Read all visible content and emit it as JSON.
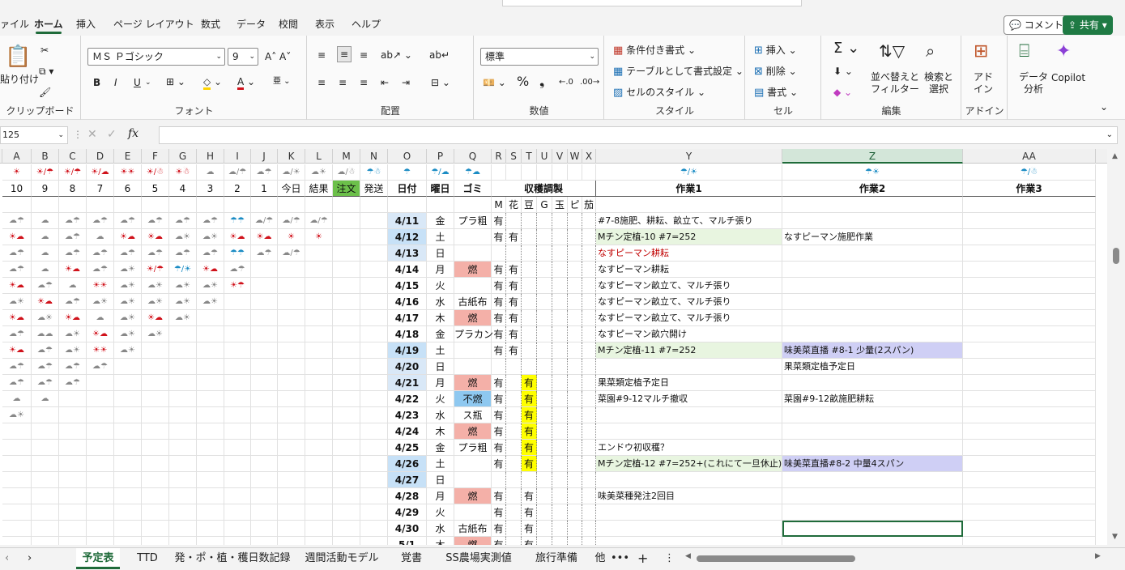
{
  "menu": {
    "tabs": [
      "ァイル",
      "ホーム",
      "挿入",
      "ページ レイアウト",
      "数式",
      "データ",
      "校閲",
      "表示",
      "ヘルプ"
    ],
    "comment_label": "コメント",
    "share_label": "共有"
  },
  "ribbon": {
    "clipboard": {
      "paste": "貼り付け",
      "label": "クリップボード"
    },
    "font": {
      "name": "ＭＳ Ｐゴシック",
      "size": "9",
      "label": "フォント",
      "bold": "B",
      "italic": "I",
      "underline": "U"
    },
    "alignment": {
      "label": "配置"
    },
    "number": {
      "format": "標準",
      "label": "数値"
    },
    "styles": {
      "cond": "条件付き書式",
      "table": "テーブルとして書式設定",
      "cell": "セルのスタイル",
      "label": "スタイル"
    },
    "cells": {
      "insert": "挿入",
      "delete": "削除",
      "format": "書式",
      "label": "セル"
    },
    "editing": {
      "sort": "並べ替えと\nフィルター",
      "find": "検索と\n選択",
      "label": "編集"
    },
    "addins": {
      "addin": "アド\nイン",
      "analyze": "データ\n分析",
      "copilot": "Copilot",
      "label": "アドイン"
    }
  },
  "formula_bar": {
    "name_box": "125",
    "fx": "fx",
    "value": ""
  },
  "columns": [
    {
      "h": "A",
      "w": 36
    },
    {
      "h": "B",
      "w": 34
    },
    {
      "h": "C",
      "w": 34
    },
    {
      "h": "D",
      "w": 34
    },
    {
      "h": "E",
      "w": 34
    },
    {
      "h": "F",
      "w": 34
    },
    {
      "h": "G",
      "w": 34
    },
    {
      "h": "H",
      "w": 34
    },
    {
      "h": "I",
      "w": 33
    },
    {
      "h": "J",
      "w": 33
    },
    {
      "h": "K",
      "w": 34
    },
    {
      "h": "L",
      "w": 34
    },
    {
      "h": "M",
      "w": 34
    },
    {
      "h": "N",
      "w": 34
    },
    {
      "h": "O",
      "w": 48
    },
    {
      "h": "P",
      "w": 34
    },
    {
      "h": "Q",
      "w": 46
    },
    {
      "h": "R",
      "w": 18
    },
    {
      "h": "S",
      "w": 19
    },
    {
      "h": "T",
      "w": 19
    },
    {
      "h": "U",
      "w": 19
    },
    {
      "h": "V",
      "w": 19
    },
    {
      "h": "W",
      "w": 18
    },
    {
      "h": "X",
      "w": 17
    },
    {
      "h": "Y",
      "w": 230
    },
    {
      "h": "Z",
      "w": 223
    },
    {
      "h": "AA",
      "w": 164
    }
  ],
  "weather_header": [
    "☀",
    "☀/☂",
    "☀/☂",
    "☀/☁",
    "☀☀",
    "☀/☃",
    "☀☃",
    "☁",
    "☁/☂",
    "☁☂",
    "☁/☀",
    "☁☀",
    "☁/☃",
    "☂☃",
    "☂",
    "☂/☁",
    "☂☁",
    "",
    "",
    "",
    "",
    "",
    "",
    "",
    "☂/☀",
    "☂☀",
    "☂/☃"
  ],
  "header_row": [
    "10",
    "9",
    "8",
    "7",
    "6",
    "5",
    "4",
    "3",
    "2",
    "1",
    "今日",
    "結果",
    "注文",
    "発送",
    "日付",
    "曜日",
    "ゴミ",
    "収穫調製",
    "",
    "",
    "",
    "",
    "",
    "",
    "作業1",
    "作業2",
    "作業3"
  ],
  "crop_header": [
    "M",
    "花",
    "豆",
    "G",
    "玉",
    "ピ",
    "茄"
  ],
  "rows": [
    {
      "w": [
        "☁☂",
        "☁",
        "☁☂",
        "☁☂",
        "☁☂",
        "☁☂",
        "☁☂",
        "☁☂",
        "☂☂",
        "☁/☂",
        "☁/☂",
        "☁/☂"
      ],
      "date": "4/11",
      "dow": "金",
      "gomi": "プラ粗",
      "crops": [
        "有",
        "",
        "",
        "",
        "",
        "",
        ""
      ],
      "t1": "#7-8施肥、耕耘、畝立て、マルチ張り",
      "t2": ""
    },
    {
      "w": [
        "☀☁",
        "☁",
        "☁☂",
        "☁",
        "☀☁",
        "☀☁",
        "☁☀",
        "☁☀",
        "☀☁",
        "☀☁",
        "☀",
        "☀"
      ],
      "date": "4/12",
      "dow": "土",
      "gomi": "",
      "crops": [
        "有",
        "有",
        "",
        "",
        "",
        "",
        ""
      ],
      "t1": "Mチン定植-10 #7=252",
      "t2": "なすピーマン施肥作業"
    },
    {
      "w": [
        "☁☂",
        "☁",
        "☁☂",
        "☁☂",
        "☁☂",
        "☁☂",
        "☁☂",
        "☁☂",
        "☂☂",
        "☁☂",
        "☁/☂",
        ""
      ],
      "date": "4/13",
      "dow": "日",
      "gomi": "",
      "crops": [
        "",
        "",
        "",
        "",
        "",
        "",
        ""
      ],
      "t1": "なすピーマン耕耘",
      "t2": ""
    },
    {
      "w": [
        "☁☂",
        "☁",
        "☀☁",
        "☁☂",
        "☁☀",
        "☀/☂",
        "☂/☀",
        "☀☁",
        "☁☂",
        "",
        "",
        ""
      ],
      "date": "4/14",
      "dow": "月",
      "gomi": "燃",
      "crops": [
        "有",
        "有",
        "",
        "",
        "",
        "",
        ""
      ],
      "t1": "なすピーマン耕耘",
      "t2": ""
    },
    {
      "w": [
        "☀☁",
        "☁☂",
        "☁",
        "☀☀",
        "☁☀",
        "☁☀",
        "☁☀",
        "☁☀",
        "☀☂",
        "",
        "",
        ""
      ],
      "date": "4/15",
      "dow": "火",
      "gomi": "",
      "crops": [
        "有",
        "有",
        "",
        "",
        "",
        "",
        ""
      ],
      "t1": "なすピーマン畝立て、マルチ張り",
      "t2": ""
    },
    {
      "w": [
        "☁☀",
        "☀☁",
        "☁☂",
        "☁☀",
        "☁☀",
        "☁☀",
        "☁☀",
        "☁☀",
        "",
        "",
        "",
        ""
      ],
      "date": "4/16",
      "dow": "水",
      "gomi": "古紙布",
      "crops": [
        "有",
        "有",
        "",
        "",
        "",
        "",
        ""
      ],
      "t1": "なすピーマン畝立て、マルチ張り",
      "t2": ""
    },
    {
      "w": [
        "☀☁",
        "☁☀",
        "☀☁",
        "☁",
        "☁☀",
        "☀☁",
        "☁☀",
        "",
        "",
        "",
        "",
        ""
      ],
      "date": "4/17",
      "dow": "木",
      "gomi": "燃",
      "crops": [
        "有",
        "有",
        "",
        "",
        "",
        "",
        ""
      ],
      "t1": "なすピーマン畝立て、マルチ張り",
      "t2": ""
    },
    {
      "w": [
        "☁☂",
        "☁☁",
        "☁☀",
        "☀☁",
        "☁☀",
        "☁☀",
        "",
        "",
        "",
        "",
        "",
        ""
      ],
      "date": "4/18",
      "dow": "金",
      "gomi": "プラカン",
      "crops": [
        "有",
        "有",
        "",
        "",
        "",
        "",
        ""
      ],
      "t1": "なすピーマン畝穴開け",
      "t2": ""
    },
    {
      "w": [
        "☀☁",
        "☁☂",
        "☁☀",
        "☀☀",
        "☁☀",
        "",
        "",
        "",
        "",
        "",
        "",
        ""
      ],
      "date": "4/19",
      "dow": "土",
      "gomi": "",
      "crops": [
        "有",
        "有",
        "",
        "",
        "",
        "",
        ""
      ],
      "t1": "Mチン定植-11 #7=252",
      "t2": "味美菜直播 #8-1  少量(2スパン)"
    },
    {
      "w": [
        "☁☂",
        "☁☂",
        "☁☂",
        "☁☂",
        "",
        "",
        "",
        "",
        "",
        "",
        "",
        ""
      ],
      "date": "4/20",
      "dow": "日",
      "gomi": "",
      "crops": [
        "",
        "",
        "",
        "",
        "",
        "",
        ""
      ],
      "t1": "",
      "t2": "果菜類定植予定日"
    },
    {
      "w": [
        "☁☂",
        "☁☂",
        "☁☂",
        "",
        "",
        "",
        "",
        "",
        "",
        "",
        "",
        ""
      ],
      "date": "4/21",
      "dow": "月",
      "gomi": "燃",
      "crops": [
        "有",
        "",
        "有",
        "",
        "",
        "",
        ""
      ],
      "t1": "果菜類定植予定日",
      "t2": ""
    },
    {
      "w": [
        "☁",
        "☁",
        "",
        "",
        "",
        "",
        "",
        "",
        "",
        "",
        "",
        ""
      ],
      "date": "4/22",
      "dow": "火",
      "gomi": "不燃",
      "crops": [
        "有",
        "",
        "有",
        "",
        "",
        "",
        ""
      ],
      "t1": "菜園#9-12マルチ撤収",
      "t2": "菜園#9-12畝施肥耕耘"
    },
    {
      "w": [
        "☁☀",
        "",
        "",
        "",
        "",
        "",
        "",
        "",
        "",
        "",
        "",
        ""
      ],
      "date": "4/23",
      "dow": "水",
      "gomi": "ス瓶",
      "crops": [
        "有",
        "",
        "有",
        "",
        "",
        "",
        ""
      ],
      "t1": "",
      "t2": ""
    },
    {
      "w": [
        "",
        "",
        "",
        "",
        "",
        "",
        "",
        "",
        "",
        "",
        "",
        ""
      ],
      "date": "4/24",
      "dow": "木",
      "gomi": "燃",
      "crops": [
        "有",
        "",
        "有",
        "",
        "",
        "",
        ""
      ],
      "t1": "",
      "t2": ""
    },
    {
      "w": [
        "",
        "",
        "",
        "",
        "",
        "",
        "",
        "",
        "",
        "",
        "",
        ""
      ],
      "date": "4/25",
      "dow": "金",
      "gomi": "プラ粗",
      "crops": [
        "有",
        "",
        "有",
        "",
        "",
        "",
        ""
      ],
      "t1": "エンドウ初収穫？",
      "t2": ""
    },
    {
      "w": [
        "",
        "",
        "",
        "",
        "",
        "",
        "",
        "",
        "",
        "",
        "",
        ""
      ],
      "date": "4/26",
      "dow": "土",
      "gomi": "",
      "crops": [
        "有",
        "",
        "有",
        "",
        "",
        "",
        ""
      ],
      "t1": "Mチン定植-12 #7=252+(これにて一旦休止)",
      "t2": "味美菜直播#8-2  中量4スパン"
    },
    {
      "w": [
        "",
        "",
        "",
        "",
        "",
        "",
        "",
        "",
        "",
        "",
        "",
        ""
      ],
      "date": "4/27",
      "dow": "日",
      "gomi": "",
      "crops": [
        "",
        "",
        "",
        "",
        "",
        "",
        ""
      ],
      "t1": "",
      "t2": ""
    },
    {
      "w": [
        "",
        "",
        "",
        "",
        "",
        "",
        "",
        "",
        "",
        "",
        "",
        ""
      ],
      "date": "4/28",
      "dow": "月",
      "gomi": "燃",
      "crops": [
        "有",
        "",
        "有",
        "",
        "",
        "",
        ""
      ],
      "t1": "味美菜種発注2回目",
      "t2": ""
    },
    {
      "w": [
        "",
        "",
        "",
        "",
        "",
        "",
        "",
        "",
        "",
        "",
        "",
        ""
      ],
      "date": "4/29",
      "dow": "火",
      "gomi": "",
      "crops": [
        "有",
        "",
        "有",
        "",
        "",
        "",
        ""
      ],
      "t1": "",
      "t2": ""
    },
    {
      "w": [
        "",
        "",
        "",
        "",
        "",
        "",
        "",
        "",
        "",
        "",
        "",
        ""
      ],
      "date": "4/30",
      "dow": "水",
      "gomi": "古紙布",
      "crops": [
        "有",
        "",
        "有",
        "",
        "",
        "",
        ""
      ],
      "t1": "",
      "t2": ""
    },
    {
      "w": [
        "",
        "",
        "",
        "",
        "",
        "",
        "",
        "",
        "",
        "",
        "",
        ""
      ],
      "date": "5/1",
      "dow": "木",
      "gomi": "燃",
      "crops": [
        "有",
        "",
        "有",
        "",
        "",
        "",
        ""
      ],
      "t1": "",
      "t2": ""
    }
  ],
  "sheet_tabs": [
    "予定表",
    "TTD",
    "発・ポ・植・穫日数記録",
    "週間活動モデル",
    "覚書",
    "SS農場実測値",
    "旅行準備",
    "他"
  ],
  "colors": {
    "accent": "#1f6b3a",
    "date_bg": "#d9e8f7",
    "weekend_bg": "#c7e1f7",
    "moe": "#f4b0a8",
    "funen": "#8ec8f0",
    "yellow": "#ffff00",
    "green_note": "#e8f5e0",
    "purple_note": "#cfcff5",
    "red_text": "#c00000"
  }
}
